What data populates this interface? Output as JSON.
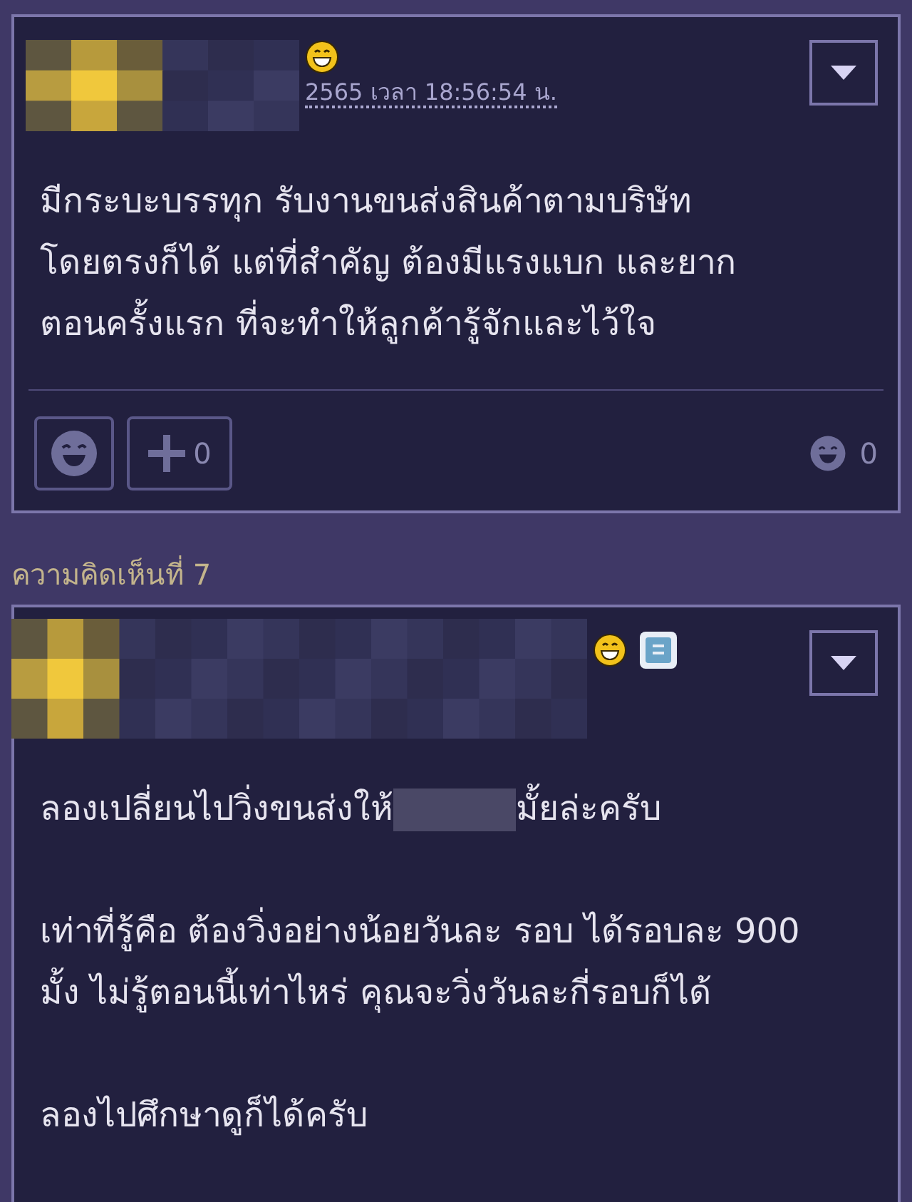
{
  "comments": [
    {
      "timestamp": "2565 เวลา 18:56:54 น.",
      "badge": false,
      "paragraphs": [
        {
          "parts": [
            "มีกระบะบรรทุก รับงานขนส่งสินค้าตามบริษัท โดยตรงก็ได้ แต่ที่สำคัญ ต้องมีแรงแบก และยาก ตอนครั้งแรก ที่จะทำให้ลูกค้ารู้จักและไว้ใจ"
          ]
        }
      ],
      "footer": {
        "plus_count": "0",
        "emotion_count": "0"
      }
    },
    {
      "label": "ความคิดเห็นที่ 7",
      "badge": true,
      "paragraphs": [
        {
          "parts": [
            "ลองเปลี่ยนไปวิ่งขนส่งให้",
            "มั้ยล่ะครับ"
          ]
        },
        {
          "parts": [
            "เท่าที่รู้คือ ต้องวิ่งอย่างน้อยวันละ รอบ ได้รอบละ 900 มั้ง ไม่รู้ตอนนี้เท่าไหร่ คุณจะวิ่งวันละกี่รอบก็ได้"
          ]
        },
        {
          "parts": [
            "ลองไปศึกษาดูก็ได้ครับ"
          ]
        }
      ]
    }
  ]
}
